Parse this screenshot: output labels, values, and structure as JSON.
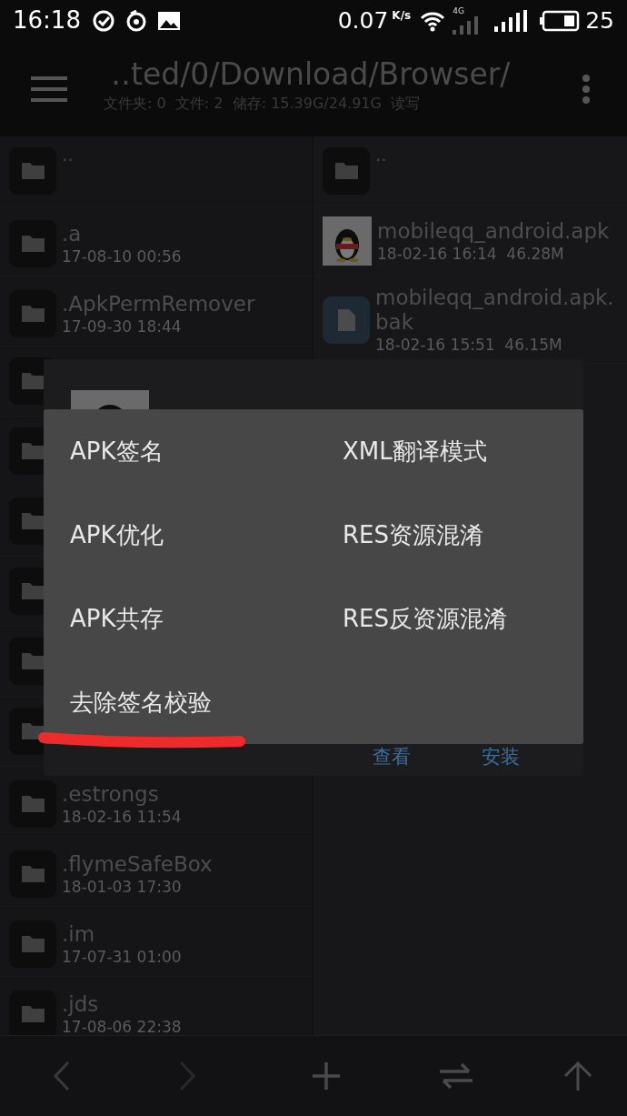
{
  "status_bar": {
    "time": "16:18",
    "speed": "0.07",
    "speed_unit": "K/s",
    "network": "4G",
    "battery": "25"
  },
  "header": {
    "path": "‥ted/0/Download/Browser/",
    "info": "文件夹: 0  文件: 2  储存: 15.39G/24.91G  读写"
  },
  "left_pane": [
    {
      "kind": "parent",
      "name": "··"
    },
    {
      "kind": "folder",
      "name": ".a",
      "meta": "17-08-10 00:56"
    },
    {
      "kind": "folder",
      "name": ".ApkPermRemover",
      "meta": "17-09-30 18:44"
    },
    {
      "kind": "covered"
    },
    {
      "kind": "covered"
    },
    {
      "kind": "covered"
    },
    {
      "kind": "covered"
    },
    {
      "kind": "covered"
    },
    {
      "kind": "covered"
    },
    {
      "kind": "folder",
      "name": ".estrongs",
      "meta": "18-02-16 11:54"
    },
    {
      "kind": "folder",
      "name": ".flymeSafeBox",
      "meta": "18-01-03 17:30"
    },
    {
      "kind": "folder",
      "name": ".im",
      "meta": "17-07-31 01:00"
    },
    {
      "kind": "folder",
      "name": ".jds",
      "meta": "17-08-06 22:38"
    }
  ],
  "right_pane": [
    {
      "kind": "parent",
      "name": "··"
    },
    {
      "kind": "apk",
      "name": "mobileqq_android.apk",
      "meta": "18-02-16 16:14  46.28M"
    },
    {
      "kind": "file",
      "name": "mobileqq_android.apk.bak",
      "meta": "18-02-16 15:51  46.15M"
    }
  ],
  "dialog": {
    "buttons": [
      "查看",
      "安装"
    ]
  },
  "menu": {
    "items": [
      {
        "label": "APK签名",
        "underlined": false
      },
      {
        "label": "XML翻译模式",
        "underlined": false
      },
      {
        "label": "APK优化",
        "underlined": false
      },
      {
        "label": "RES资源混淆",
        "underlined": false
      },
      {
        "label": "APK共存",
        "underlined": false
      },
      {
        "label": "RES反资源混淆",
        "underlined": false
      },
      {
        "label": "去除签名校验",
        "underlined": true
      }
    ]
  }
}
